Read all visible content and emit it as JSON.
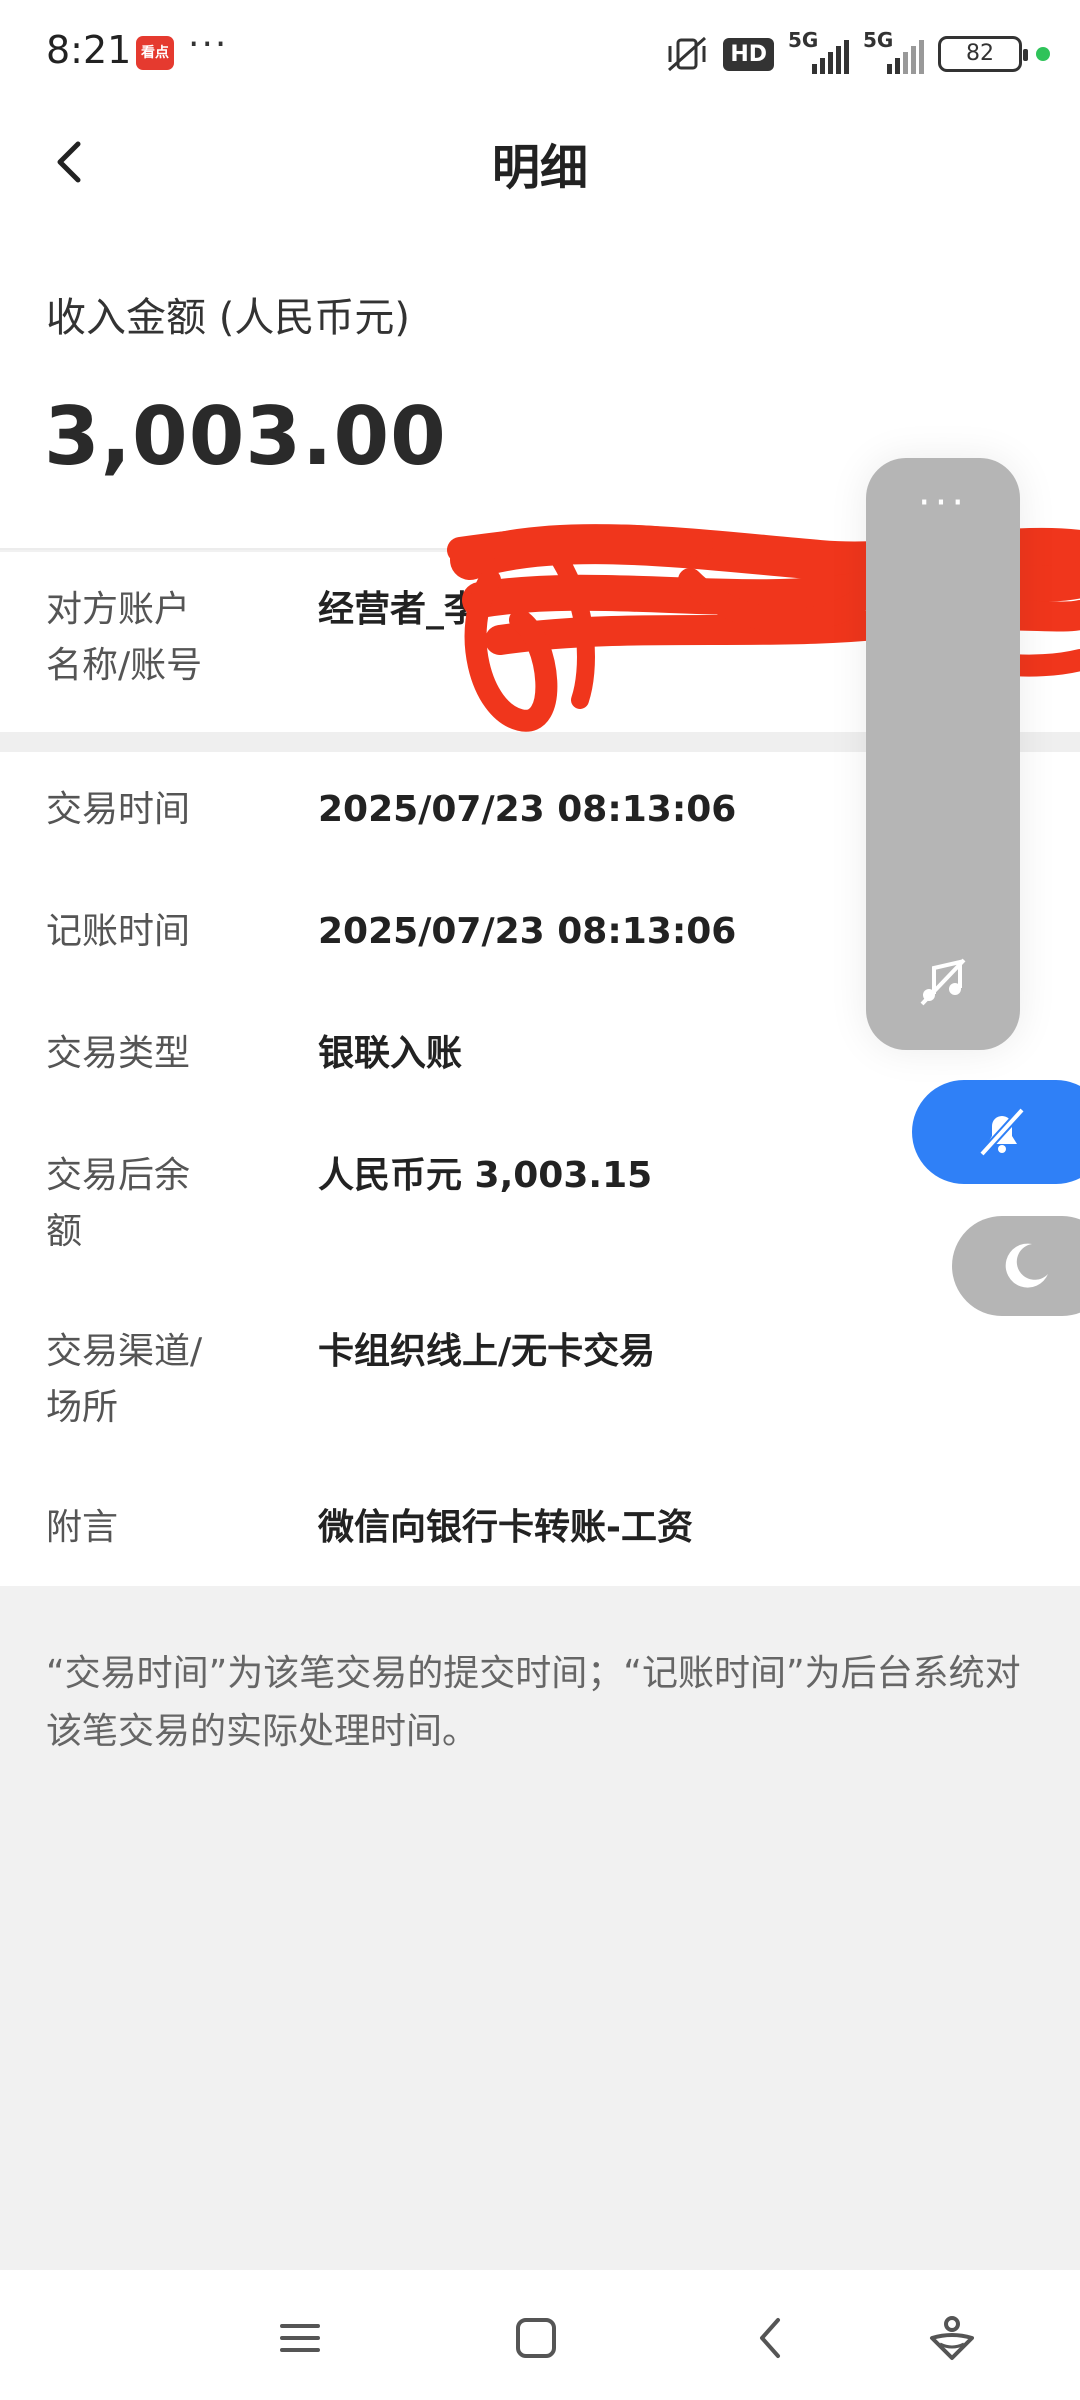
{
  "status_bar": {
    "time": "8:21",
    "app_badge": "看点",
    "hd": "HD",
    "net1": "5G",
    "net2": "5G",
    "battery": "82"
  },
  "header": {
    "title": "明细"
  },
  "amount": {
    "label": "收入金额 (人民币元)",
    "value": "3,003.00"
  },
  "counterparty": {
    "label_line1": "对方账户",
    "label_line2": "名称/账号",
    "value": "经营者_李"
  },
  "details": [
    {
      "label_line1": "交易时间",
      "label_line2": "",
      "value": "2025/07/23 08:13:06"
    },
    {
      "label_line1": "记账时间",
      "label_line2": "",
      "value": "2025/07/23 08:13:06"
    },
    {
      "label_line1": "交易类型",
      "label_line2": "",
      "value": "银联入账"
    },
    {
      "label_line1": "交易后余",
      "label_line2": "额",
      "value": "人民币元 3,003.15"
    },
    {
      "label_line1": "交易渠道/",
      "label_line2": "场所",
      "value": "卡组织线上/无卡交易"
    },
    {
      "label_line1": "附言",
      "label_line2": "",
      "value": "微信向银行卡转账-工资"
    }
  ],
  "footnote": "“交易时间”为该笔交易的提交时间；“记账时间”为后台系统对该笔交易的实际处理时间。",
  "float_panel": {
    "dots": "···"
  },
  "icons": {
    "back": "chevron-left-icon",
    "music_off": "music-off-icon",
    "bell_off": "bell-off-icon",
    "moon": "moon-icon",
    "menu": "menu-icon",
    "home": "home-square-icon",
    "nav_back": "nav-back-icon",
    "assistant": "assistant-icon"
  },
  "colors": {
    "accent_blue": "#2f80f7",
    "redaction": "#f0361c",
    "status_green": "#2fc35a"
  }
}
